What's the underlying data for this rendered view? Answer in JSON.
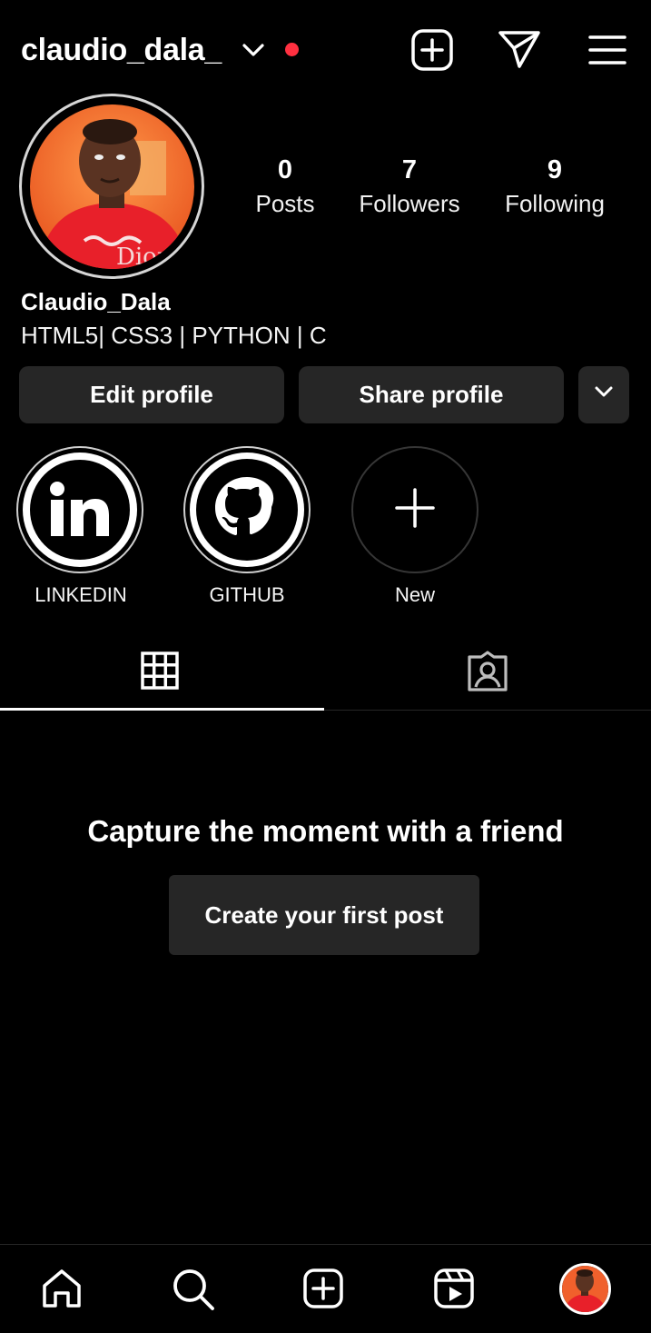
{
  "header": {
    "username": "claudio_dala_",
    "notification_dot_color": "#ff3040",
    "icons": [
      "chevron-down-icon",
      "new-post-icon",
      "direct-message-icon",
      "menu-icon"
    ]
  },
  "profile": {
    "display_name": "Claudio_Dala",
    "bio": "HTML5| CSS3 | PYTHON | C",
    "stats": [
      {
        "value": "0",
        "label": "Posts"
      },
      {
        "value": "7",
        "label": "Followers"
      },
      {
        "value": "9",
        "label": "Following"
      }
    ]
  },
  "actions": {
    "edit_label": "Edit profile",
    "share_label": "Share profile"
  },
  "highlights": [
    {
      "label": "LINKEDIN",
      "icon": "linkedin-icon"
    },
    {
      "label": "GITHUB",
      "icon": "github-icon"
    },
    {
      "label": "New",
      "icon": "plus-icon"
    }
  ],
  "tabs": [
    {
      "name": "grid",
      "icon": "grid-icon",
      "active": true
    },
    {
      "name": "tagged",
      "icon": "tagged-icon",
      "active": false
    }
  ],
  "empty_state": {
    "title": "Capture the moment with a friend",
    "button_label": "Create your first post"
  },
  "bottom_nav": [
    "home-icon",
    "search-icon",
    "create-icon",
    "reels-icon",
    "profile-avatar"
  ],
  "colors": {
    "background": "#000000",
    "button_bg": "#262626",
    "text": "#ffffff",
    "avatar_orange": "#f0602c",
    "shirt_red": "#e8202a"
  }
}
